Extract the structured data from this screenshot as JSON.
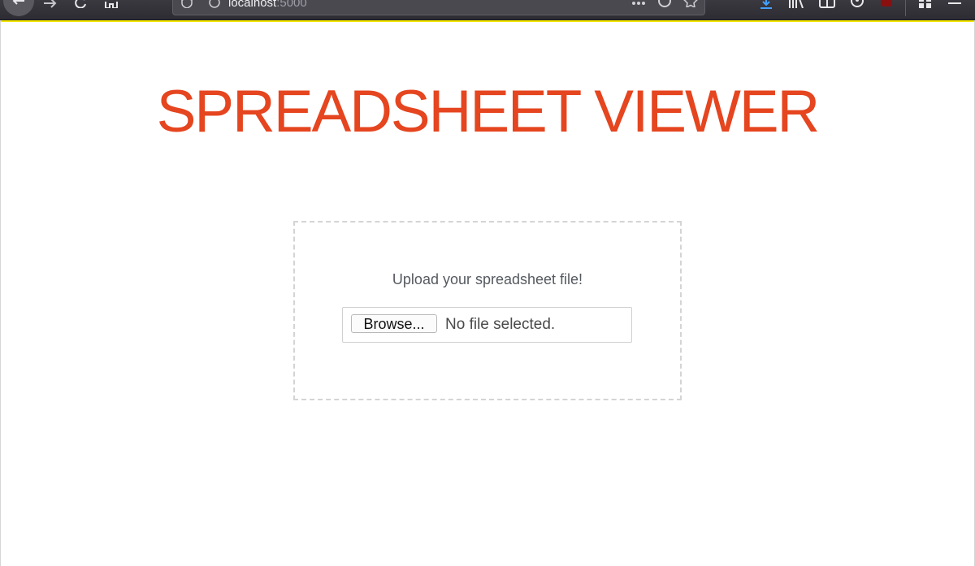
{
  "browser": {
    "url_host": "localhost",
    "url_port": ":5000"
  },
  "page": {
    "title": "SPREADSHEET VIEWER",
    "accent_color": "#e5451f"
  },
  "upload": {
    "prompt": "Upload your spreadsheet file!",
    "browse_label": "Browse...",
    "file_status": "No file selected."
  },
  "icons": [
    "back-arrow-icon",
    "forward-arrow-icon",
    "reload-icon",
    "home-icon",
    "tracking-shield-icon",
    "info-icon",
    "page-actions-icon",
    "pocket-icon",
    "bookmark-star-icon",
    "download-icon",
    "library-icon",
    "sidebar-icon",
    "account-icon",
    "extension-icon",
    "grid-icon",
    "menu-icon"
  ]
}
